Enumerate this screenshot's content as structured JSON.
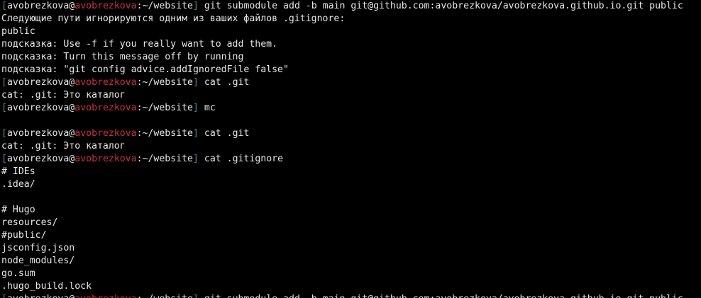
{
  "terminal": {
    "prompt": {
      "open_bracket": "[",
      "user": "avobrezkova",
      "at": "@",
      "host": "avobrezkova",
      "path": ":~/website",
      "close_bracket": "]"
    },
    "lines": [
      {
        "type": "prompt",
        "command": "git submodule add -b main git@github.com:avobrezkova/avobrezkova.github.io.git public"
      },
      {
        "type": "output",
        "text": "Следующие пути игнорируются одним из ваших файлов .gitignore:"
      },
      {
        "type": "output",
        "text": "public"
      },
      {
        "type": "output",
        "text": "подсказка: Use -f if you really want to add them."
      },
      {
        "type": "output",
        "text": "подсказка: Turn this message off by running"
      },
      {
        "type": "output",
        "text": "подсказка: \"git config advice.addIgnoredFile false\""
      },
      {
        "type": "prompt",
        "command": "cat .git"
      },
      {
        "type": "output",
        "text": "cat: .git: Это каталог"
      },
      {
        "type": "prompt",
        "command": "mc"
      },
      {
        "type": "output",
        "text": ""
      },
      {
        "type": "prompt",
        "command": "cat .git"
      },
      {
        "type": "output",
        "text": "cat: .git: Это каталог"
      },
      {
        "type": "prompt",
        "command": "cat .gitignore"
      },
      {
        "type": "output",
        "text": "# IDEs"
      },
      {
        "type": "output",
        "text": ".idea/"
      },
      {
        "type": "output",
        "text": ""
      },
      {
        "type": "output",
        "text": "# Hugo"
      },
      {
        "type": "output",
        "text": "resources/"
      },
      {
        "type": "output",
        "text": "#public/"
      },
      {
        "type": "output",
        "text": "jsconfig.json"
      },
      {
        "type": "output",
        "text": "node_modules/"
      },
      {
        "type": "output",
        "text": "go.sum"
      },
      {
        "type": "output",
        "text": ".hugo_build.lock"
      }
    ],
    "partial_line": {
      "command": "git submodule add -b main git@github.com:avobrezkova/avobrezkova.github.io.git public"
    },
    "colors": {
      "background": "#000000",
      "text": "#e6e6e6",
      "bracket": "#4a8a9a",
      "host": "#c8333b"
    }
  }
}
